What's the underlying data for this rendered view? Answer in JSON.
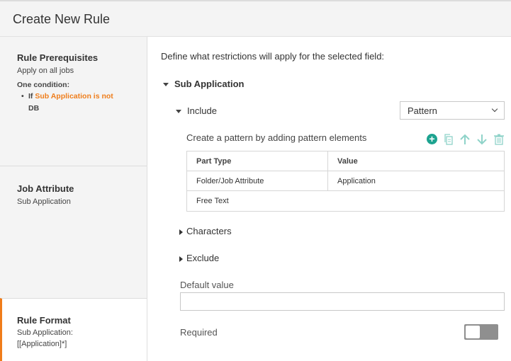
{
  "header": {
    "title": "Create New Rule"
  },
  "sidebar": {
    "prerequisites": {
      "title": "Rule Prerequisites",
      "subtitle": "Apply on all jobs",
      "condition_count": "One condition:",
      "condition_prefix": "If",
      "condition_highlight": "Sub Application is not",
      "condition_suffix": "DB"
    },
    "job_attribute": {
      "title": "Job Attribute",
      "value": "Sub Application"
    },
    "rule_format": {
      "title": "Rule Format",
      "line1": "Sub Application:",
      "line2": "[[Application]*]"
    }
  },
  "main": {
    "intro": "Define what restrictions will apply for the selected field:",
    "section_title": "Sub Application",
    "include_label": "Include",
    "include_select_value": "Pattern",
    "pattern_label": "Create a pattern by adding pattern elements",
    "toolbar_icons": [
      "add-icon",
      "copy-icon",
      "arrow-up-icon",
      "arrow-down-icon",
      "trash-icon"
    ],
    "table": {
      "headers": [
        "Part Type",
        "Value"
      ],
      "rows": [
        [
          "Folder/Job Attribute",
          "Application"
        ],
        [
          "Free Text",
          ""
        ]
      ]
    },
    "characters_label": "Characters",
    "exclude_label": "Exclude",
    "default_value_label": "Default value",
    "default_value": "",
    "required_label": "Required"
  },
  "colors": {
    "accent_orange": "#ef7e1c",
    "teal": "#1da390",
    "toggle_off": "#8f8f8f"
  }
}
